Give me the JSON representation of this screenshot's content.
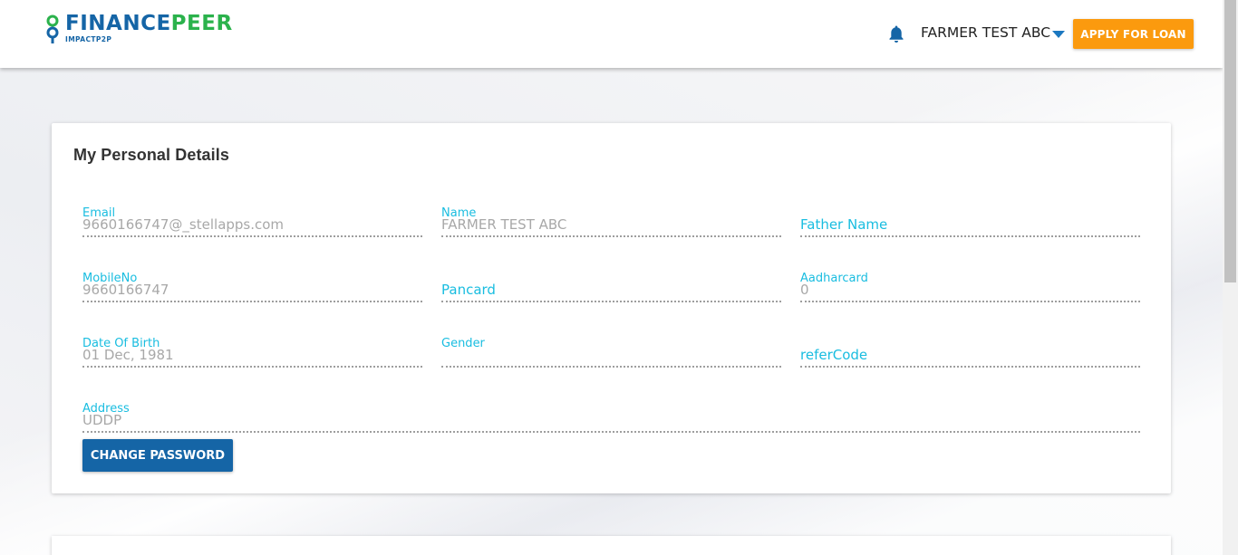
{
  "header": {
    "logo_word_1": "FINANCE",
    "logo_word_2": "PEER",
    "logo_sub": "IMPACTP2P",
    "user_name": "FARMER TEST ABC",
    "apply_label": "APPLY FOR LOAN"
  },
  "colors": {
    "brand_blue": "#1565a6",
    "brand_green": "#2bb24c",
    "accent_orange": "#fb9a0e",
    "label_cyan": "#19bde0"
  },
  "card": {
    "title": "My Personal Details",
    "fields": [
      {
        "label": "Email",
        "value": "9660166747@_stellapps.com"
      },
      {
        "label": "Name",
        "value": "FARMER TEST ABC"
      },
      {
        "label": "Father Name",
        "value": ""
      },
      {
        "label": "MobileNo",
        "value": "9660166747"
      },
      {
        "label": "Pancard",
        "value": ""
      },
      {
        "label": "Aadharcard",
        "value": "0"
      },
      {
        "label": "Date Of Birth",
        "value": "01 Dec, 1981"
      },
      {
        "label": "Gender",
        "value": ""
      },
      {
        "label": "referCode",
        "value": ""
      },
      {
        "label": "Address",
        "value": "UDDP"
      }
    ],
    "change_password_label": "CHANGE PASSWORD"
  },
  "icons": {
    "bell": "bell-icon",
    "dropdown": "chevron-down-icon",
    "logo": "financepeer-logo"
  }
}
